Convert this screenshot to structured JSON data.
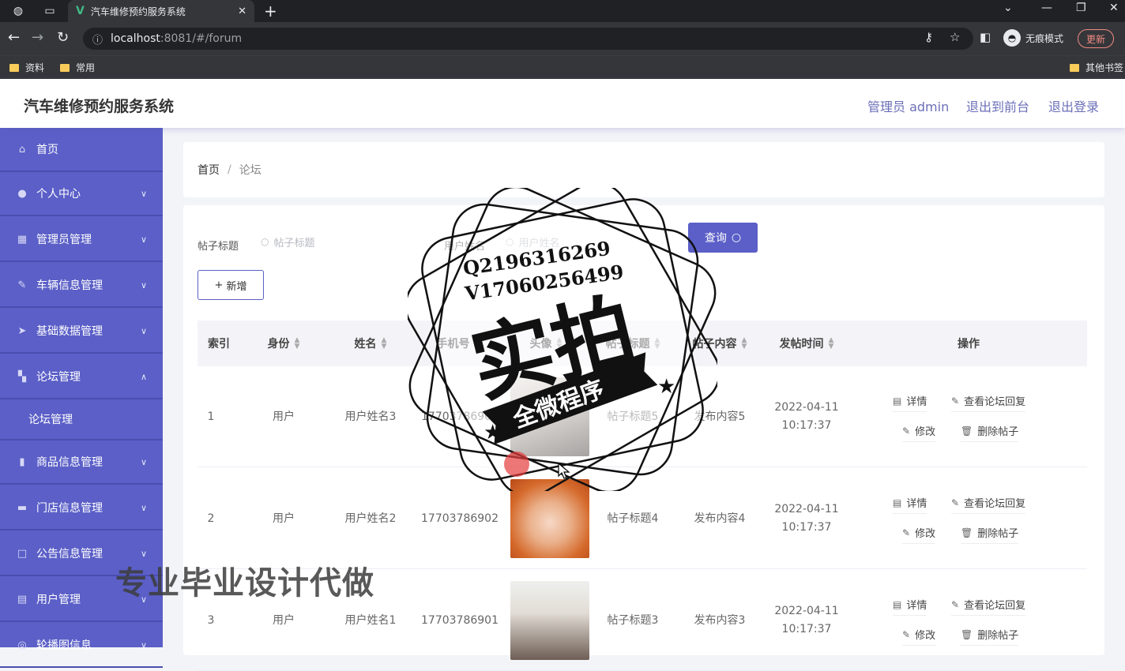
{
  "browser": {
    "tab_title": "汽车维修预约服务系统",
    "url_host": "localhost",
    "url_path": ":8081/#/forum",
    "incognito_label": "无痕模式",
    "update_label": "更新",
    "bookmarks": [
      "资料",
      "常用"
    ],
    "other_bookmarks": "其他书签"
  },
  "header": {
    "title": "汽车维修预约服务系统",
    "admin_label": "管理员 admin",
    "back_front_label": "退出到前台",
    "logout_label": "退出登录"
  },
  "sidebar": {
    "items": [
      {
        "label": "首页",
        "icon": "home-icon"
      },
      {
        "label": "个人中心",
        "icon": "user-icon"
      },
      {
        "label": "管理员管理",
        "icon": "keyboard-icon"
      },
      {
        "label": "车辆信息管理",
        "icon": "brush-icon"
      },
      {
        "label": "基础数据管理",
        "icon": "send-icon"
      },
      {
        "label": "论坛管理",
        "icon": "grid-icon"
      },
      {
        "label": "商品信息管理",
        "icon": "bar-chart-icon"
      },
      {
        "label": "门店信息管理",
        "icon": "video-icon"
      },
      {
        "label": "公告信息管理",
        "icon": "box-icon"
      },
      {
        "label": "用户管理",
        "icon": "bag-icon"
      },
      {
        "label": "轮播图信息",
        "icon": "target-icon"
      }
    ],
    "subitem_forum": "论坛管理"
  },
  "breadcrumb": {
    "home": "首页",
    "separator": "/",
    "current": "论坛"
  },
  "search": {
    "title_label": "帖子标题",
    "title_placeholder": "帖子标题",
    "name_label": "用户姓名",
    "name_placeholder": "用户姓名",
    "query_label": "查询",
    "add_label": "新增"
  },
  "table": {
    "headers": [
      "索引",
      "身份",
      "姓名",
      "手机号",
      "头像",
      "帖子标题",
      "帖子内容",
      "发帖时间",
      "操作"
    ],
    "rows": [
      {
        "index": "1",
        "role": "用户",
        "name": "用户姓名3",
        "phone": "17703786903",
        "title": "帖子标题5",
        "content": "发布内容5",
        "date": "2022-04-11",
        "time": "10:17:37"
      },
      {
        "index": "2",
        "role": "用户",
        "name": "用户姓名2",
        "phone": "17703786902",
        "title": "帖子标题4",
        "content": "发布内容4",
        "date": "2022-04-11",
        "time": "10:17:37"
      },
      {
        "index": "3",
        "role": "用户",
        "name": "用户姓名1",
        "phone": "17703786901",
        "title": "帖子标题3",
        "content": "发布内容3",
        "date": "2022-04-11",
        "time": "10:17:37"
      }
    ],
    "ops": {
      "detail": "详情",
      "view_reply": "查看论坛回复",
      "edit": "修改",
      "delete": "删除帖子"
    }
  },
  "stamp": {
    "qq": "Q2196316269",
    "wechat": "V17060256499",
    "main": "实拍",
    "ribbon": "全微程序"
  },
  "watermark": "专业毕业设计代做"
}
